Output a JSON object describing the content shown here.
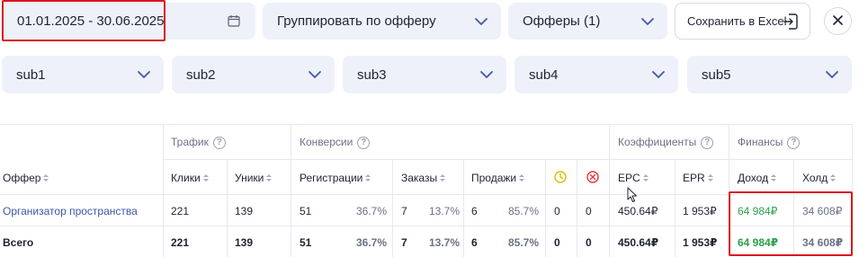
{
  "filters": {
    "date_range": "01.01.2025 - 30.06.2025",
    "group_by": "Группировать по офферу",
    "offers": "Офферы (1)",
    "save_excel": "Сохранить в Excel",
    "subs": [
      "sub1",
      "sub2",
      "sub3",
      "sub4",
      "sub5"
    ]
  },
  "table": {
    "groups": {
      "traffic": "Трафик",
      "conversions": "Конверсии",
      "coefficients": "Коэффициенты",
      "finance": "Финансы"
    },
    "columns": {
      "offer": "Оффер",
      "clicks": "Клики",
      "uniques": "Уники",
      "registrations": "Регистрации",
      "orders": "Заказы",
      "sales": "Продажи",
      "epc": "EPC",
      "epr": "EPR",
      "income": "Доход",
      "hold": "Холд"
    },
    "rows": [
      {
        "offer": "Организатор пространства",
        "clicks": "221",
        "uniques": "139",
        "registrations": "51",
        "registrations_pct": "36.7%",
        "orders": "7",
        "orders_pct": "13.7%",
        "sales": "6",
        "sales_pct": "85.7%",
        "pending": "0",
        "rejected": "0",
        "epc": "450.64₽",
        "epr": "1 953₽",
        "income": "64 984₽",
        "hold": "34 608₽"
      },
      {
        "offer": "Всего",
        "clicks": "221",
        "uniques": "139",
        "registrations": "51",
        "registrations_pct": "36.7%",
        "orders": "7",
        "orders_pct": "13.7%",
        "sales": "6",
        "sales_pct": "85.7%",
        "pending": "0",
        "rejected": "0",
        "epc": "450.64₽",
        "epr": "1 953₽",
        "income": "64 984₽",
        "hold": "34 608₽"
      }
    ]
  },
  "colors": {
    "accent": "#3e57a8",
    "highlight": "#d9161c",
    "positive": "#2aa14a",
    "pending": "#e6b800",
    "rejected": "#e23b3b"
  }
}
